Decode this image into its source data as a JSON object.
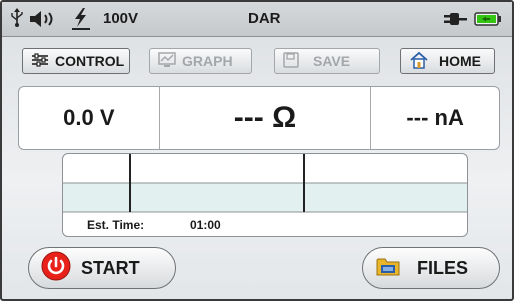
{
  "status": {
    "voltage": "100V",
    "mode": "DAR"
  },
  "tabs": {
    "control": "CONTROL",
    "graph": "GRAPH",
    "save": "SAVE",
    "home": "HOME"
  },
  "readings": {
    "voltage": "0.0 V",
    "resistance": "--- Ω",
    "current": "--- nA"
  },
  "graph": {
    "est_label": "Est. Time:",
    "est_value": "01:00"
  },
  "actions": {
    "start": "START",
    "files": "FILES"
  },
  "colors": {
    "start_red": "#e8211b",
    "battery_green": "#33c414",
    "graph_band": "#e2f1ef"
  }
}
